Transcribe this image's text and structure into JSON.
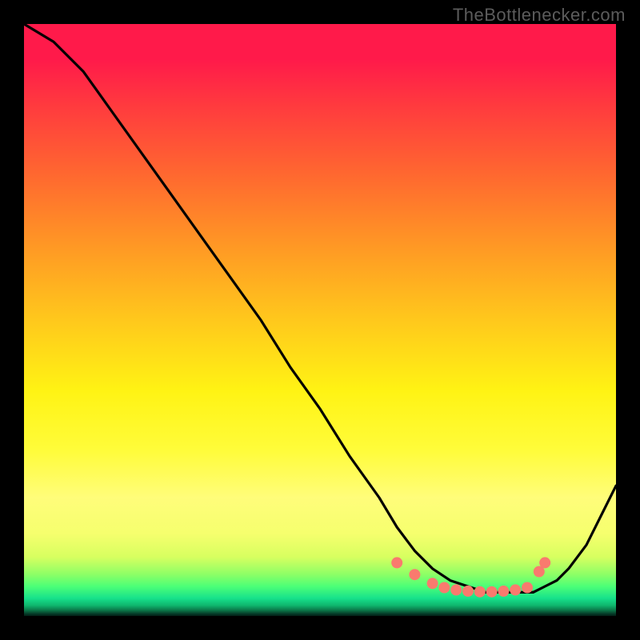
{
  "attribution": "TheBottlenecker.com",
  "chart_data": {
    "type": "line",
    "title": "",
    "xlabel": "",
    "ylabel": "",
    "xlim": [
      0,
      100
    ],
    "ylim": [
      0,
      100
    ],
    "series": [
      {
        "name": "curve",
        "x": [
          0,
          5,
          10,
          15,
          20,
          25,
          30,
          35,
          40,
          45,
          50,
          55,
          60,
          63,
          66,
          69,
          72,
          75,
          78,
          80,
          82,
          84,
          86,
          88,
          90,
          92,
          95,
          100
        ],
        "y": [
          100,
          97,
          92,
          85,
          78,
          71,
          64,
          57,
          50,
          42,
          35,
          27,
          20,
          15,
          11,
          8,
          6,
          5,
          4,
          4,
          4,
          4,
          4,
          5,
          6,
          8,
          12,
          22
        ]
      }
    ],
    "markers": {
      "name": "trough-points",
      "color": "#f97a6e",
      "radius_px": 7,
      "points": [
        {
          "x": 63,
          "y": 9
        },
        {
          "x": 66,
          "y": 7
        },
        {
          "x": 69,
          "y": 5.5
        },
        {
          "x": 71,
          "y": 4.8
        },
        {
          "x": 73,
          "y": 4.4
        },
        {
          "x": 75,
          "y": 4.2
        },
        {
          "x": 77,
          "y": 4.1
        },
        {
          "x": 79,
          "y": 4.1
        },
        {
          "x": 81,
          "y": 4.2
        },
        {
          "x": 83,
          "y": 4.4
        },
        {
          "x": 85,
          "y": 4.8
        },
        {
          "x": 87,
          "y": 7.5
        },
        {
          "x": 88,
          "y": 9
        }
      ]
    },
    "background": {
      "heatmap": true,
      "top_color": "#ff1a4a",
      "mid_color": "#fff314",
      "bottom_color": "#17e28b"
    }
  }
}
